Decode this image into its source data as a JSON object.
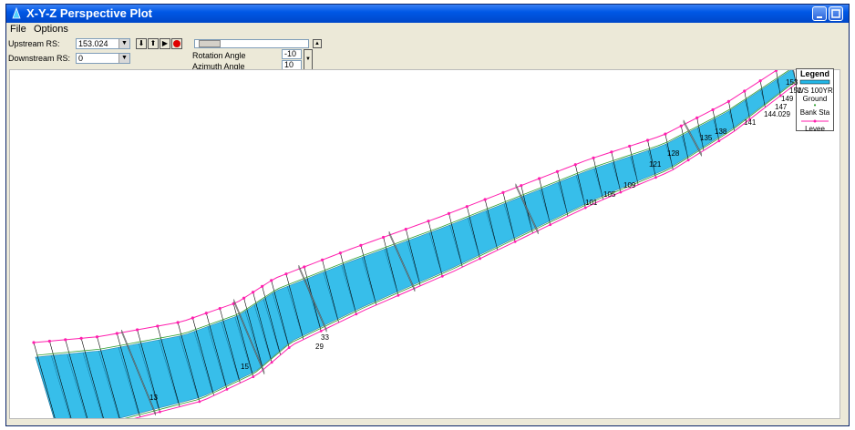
{
  "window": {
    "title": "X-Y-Z Perspective Plot"
  },
  "menu": [
    "File",
    "Options"
  ],
  "controls": {
    "upstream_label": "Upstream RS:",
    "upstream_value": "153.024",
    "downstream_label": "Downstream RS:",
    "downstream_value": "0",
    "rotation_label": "Rotation Angle",
    "rotation_value": "-10",
    "azimuth_label": "Azimuth Angle",
    "azimuth_value": "10"
  },
  "legend": {
    "title": "Legend",
    "items": [
      "WS 100YR",
      "Ground",
      "Bank Sta",
      "Levee"
    ]
  },
  "station_labels": [
    "153",
    "151",
    "149",
    "147",
    "144.029",
    "141",
    "138",
    "135",
    "128",
    "121",
    "109",
    "105",
    "101",
    "33",
    "29",
    "15",
    "13"
  ],
  "colors": {
    "water": "#22b8e8",
    "levee": "#ff1fae",
    "ground": "#000000",
    "bank": "#2e9e2e",
    "structure": "#888888"
  }
}
